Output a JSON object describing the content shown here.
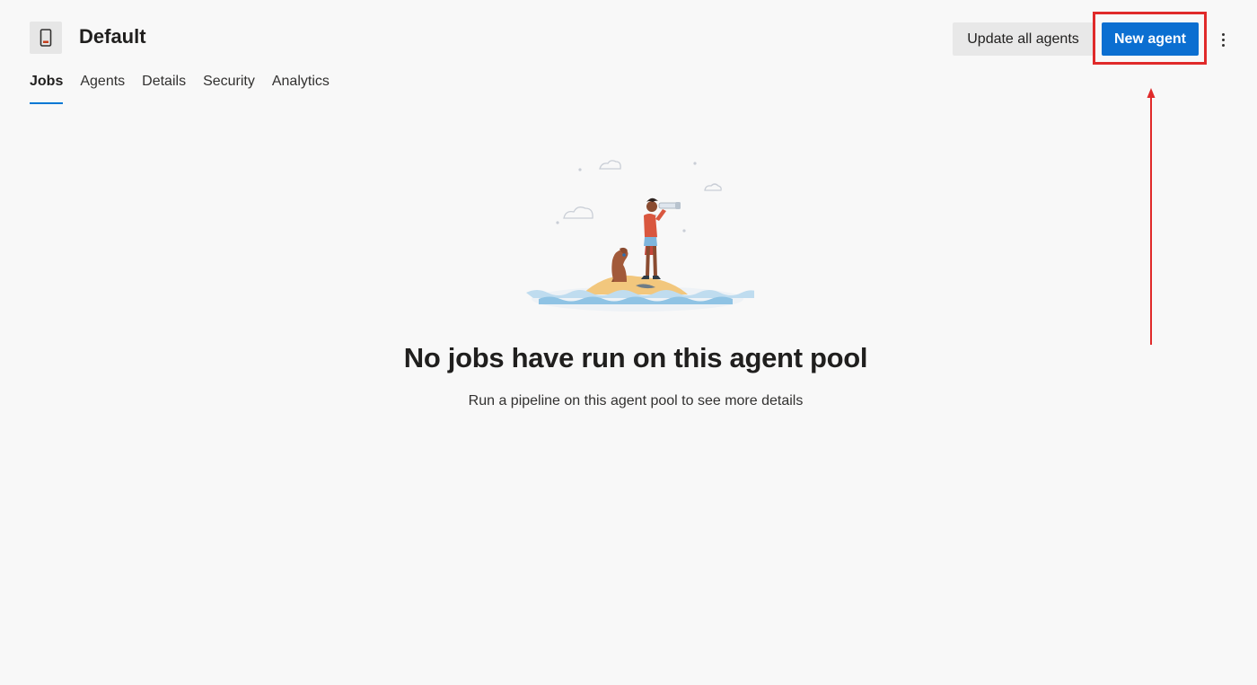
{
  "header": {
    "pool_icon": "phone-device-icon",
    "title": "Default"
  },
  "tabs": [
    {
      "label": "Jobs",
      "active": true
    },
    {
      "label": "Agents",
      "active": false
    },
    {
      "label": "Details",
      "active": false
    },
    {
      "label": "Security",
      "active": false
    },
    {
      "label": "Analytics",
      "active": false
    }
  ],
  "actions": {
    "update_all_label": "Update all agents",
    "new_agent_label": "New agent",
    "more_icon": "more-vertical-icon"
  },
  "annotation": {
    "highlight_color": "#e02a2a",
    "arrow_color": "#e02a2a"
  },
  "empty_state": {
    "illustration": "island-lookout-illustration",
    "title": "No jobs have run on this agent pool",
    "subtitle": "Run a pipeline on this agent pool to see more details"
  },
  "colors": {
    "accent": "#0b6fd1",
    "background": "#f8f8f8"
  }
}
